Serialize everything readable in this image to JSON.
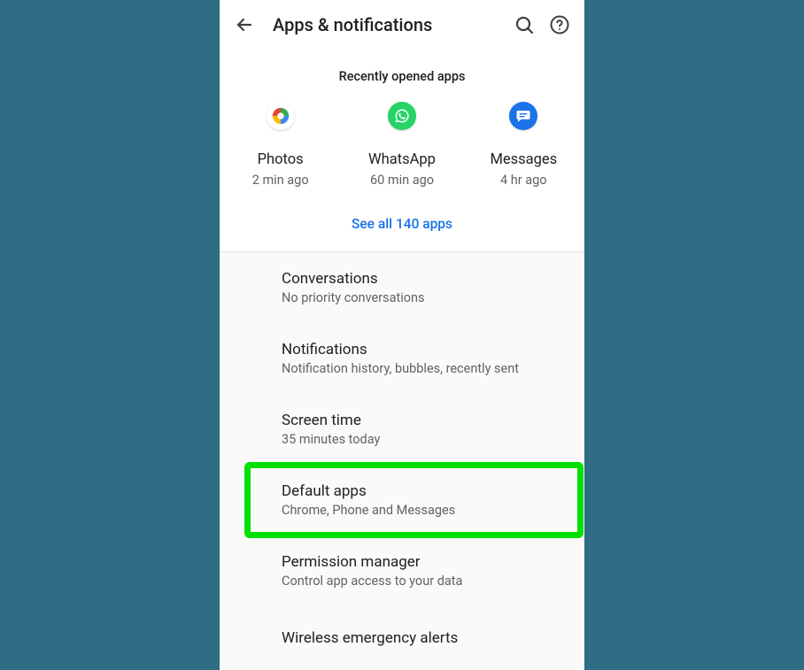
{
  "appbar": {
    "title": "Apps & notifications"
  },
  "recent": {
    "heading": "Recently opened apps",
    "apps": [
      {
        "name": "Photos",
        "time": "2 min ago"
      },
      {
        "name": "WhatsApp",
        "time": "60 min ago"
      },
      {
        "name": "Messages",
        "time": "4 hr ago"
      }
    ],
    "see_all": "See all 140 apps"
  },
  "settings": [
    {
      "title": "Conversations",
      "sub": "No priority conversations"
    },
    {
      "title": "Notifications",
      "sub": "Notification history, bubbles, recently sent"
    },
    {
      "title": "Screen time",
      "sub": "35 minutes today"
    },
    {
      "title": "Default apps",
      "sub": "Chrome, Phone and Messages",
      "highlight": true
    },
    {
      "title": "Permission manager",
      "sub": "Control app access to your data"
    },
    {
      "title": "Wireless emergency alerts"
    }
  ]
}
